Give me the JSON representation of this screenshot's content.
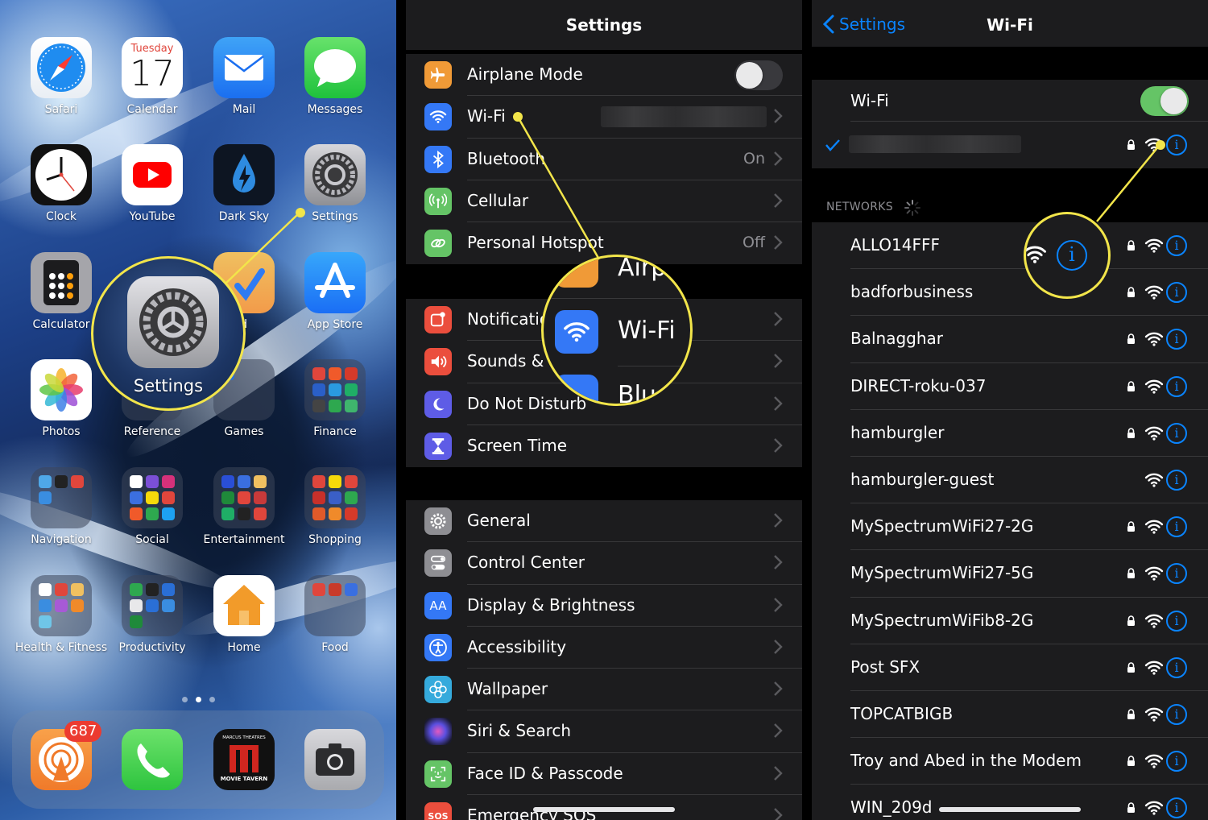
{
  "home": {
    "calendar": {
      "weekday": "Tuesday",
      "day": "17"
    },
    "apps": [
      {
        "label": "Safari",
        "icon": "safari-icon"
      },
      {
        "label": "Calendar",
        "icon": "calendar-icon"
      },
      {
        "label": "Mail",
        "icon": "mail-icon"
      },
      {
        "label": "Messages",
        "icon": "messages-icon"
      },
      {
        "label": "Clock",
        "icon": "clock-icon"
      },
      {
        "label": "YouTube",
        "icon": "youtube-icon"
      },
      {
        "label": "Dark Sky",
        "icon": "dark-sky-icon"
      },
      {
        "label": "Settings",
        "icon": "settings-gear-icon"
      },
      {
        "label": "Calculator",
        "icon": "calculator-icon"
      },
      {
        "label": "Word",
        "icon": "word-icon"
      },
      {
        "label": "App Store",
        "icon": "app-store-icon"
      },
      {
        "label": "Photos",
        "icon": "photos-icon"
      },
      {
        "label": "Reference",
        "icon": "folder-icon"
      },
      {
        "label": "Games",
        "icon": "folder-icon"
      },
      {
        "label": "Finance",
        "icon": "folder-icon"
      },
      {
        "label": "Navigation",
        "icon": "folder-icon"
      },
      {
        "label": "Social",
        "icon": "folder-icon"
      },
      {
        "label": "Entertainment",
        "icon": "folder-icon"
      },
      {
        "label": "Shopping",
        "icon": "folder-icon"
      },
      {
        "label": "Health & Fitness",
        "icon": "folder-icon"
      },
      {
        "label": "Productivity",
        "icon": "folder-icon"
      },
      {
        "label": "Home",
        "icon": "home-icon"
      },
      {
        "label": "Food",
        "icon": "folder-icon"
      }
    ],
    "word_label_partial": "ord",
    "dock": {
      "overcast_badge": "687",
      "movie_tavern_top": "MARCUS THEATRES",
      "movie_tavern_bottom": "MOVIE TAVERN"
    },
    "magnifier_label": "Settings"
  },
  "settings": {
    "title": "Settings",
    "groups": [
      [
        {
          "label": "Airplane Mode",
          "icon": "airplane-icon",
          "color": "#f09a37",
          "control": "toggle-off"
        },
        {
          "label": "Wi-Fi",
          "icon": "wifi-icon",
          "color": "#3478f6",
          "value": "",
          "control": "chevron"
        },
        {
          "label": "Bluetooth",
          "icon": "bluetooth-icon",
          "color": "#3478f6",
          "value": "On",
          "control": "chevron"
        },
        {
          "label": "Cellular",
          "icon": "cellular-icon",
          "color": "#65c466",
          "value": "",
          "control": "chevron"
        },
        {
          "label": "Personal Hotspot",
          "icon": "hotspot-icon",
          "color": "#65c466",
          "value": "Off",
          "control": "chevron"
        }
      ],
      [
        {
          "label": "Notifications",
          "icon": "notifications-icon",
          "color": "#eb4e3d",
          "value": "",
          "control": "chevron"
        },
        {
          "label": "Sounds & Haptics",
          "icon": "sounds-icon",
          "color": "#eb4e3d",
          "value": "",
          "control": "chevron"
        },
        {
          "label": "Do Not Disturb",
          "icon": "moon-icon",
          "color": "#5e5ce6",
          "value": "",
          "control": "chevron"
        },
        {
          "label": "Screen Time",
          "icon": "hourglass-icon",
          "color": "#5e5ce6",
          "value": "",
          "control": "chevron"
        }
      ],
      [
        {
          "label": "General",
          "icon": "gear-icon",
          "color": "#8e8e93",
          "value": "",
          "control": "chevron"
        },
        {
          "label": "Control Center",
          "icon": "control-center-icon",
          "color": "#8e8e93",
          "value": "",
          "control": "chevron"
        },
        {
          "label": "Display & Brightness",
          "icon": "display-icon",
          "color": "#3478f6",
          "value": "",
          "control": "chevron"
        },
        {
          "label": "Accessibility",
          "icon": "accessibility-icon",
          "color": "#3478f6",
          "value": "",
          "control": "chevron"
        },
        {
          "label": "Wallpaper",
          "icon": "wallpaper-icon",
          "color": "#35aadc",
          "value": "",
          "control": "chevron"
        },
        {
          "label": "Siri & Search",
          "icon": "siri-icon",
          "color": "#222",
          "value": "",
          "control": "chevron"
        },
        {
          "label": "Face ID & Passcode",
          "icon": "face-id-icon",
          "color": "#65c466",
          "value": "",
          "control": "chevron"
        },
        {
          "label": "Emergency SOS",
          "icon": "sos-icon",
          "color": "#eb4e3d",
          "value": "",
          "control": "chevron"
        }
      ]
    ],
    "display_icon_text": "AA",
    "sos_icon_text": "SOS",
    "magnifier": {
      "top": "Airp",
      "middle": "Wi-Fi",
      "bottom": "Blu"
    }
  },
  "wifi": {
    "back_label": "Settings",
    "title": "Wi-Fi",
    "toggle_label": "Wi-Fi",
    "toggle_on": true,
    "networks_header": "NETWORKS",
    "networks": [
      {
        "name": "ALLO14FFF",
        "locked": true
      },
      {
        "name": "badforbusiness",
        "locked": true
      },
      {
        "name": "Balnagghar",
        "locked": true
      },
      {
        "name": "DIRECT-roku-037",
        "locked": true
      },
      {
        "name": "hamburgler",
        "locked": true
      },
      {
        "name": "hamburgler-guest",
        "locked": false
      },
      {
        "name": "MySpectrumWiFi27-2G",
        "locked": true
      },
      {
        "name": "MySpectrumWiFi27-5G",
        "locked": true
      },
      {
        "name": "MySpectrumWiFib8-2G",
        "locked": true
      },
      {
        "name": "Post SFX",
        "locked": true
      },
      {
        "name": "TOPCATBIGB",
        "locked": true
      },
      {
        "name": "Troy and Abed in the Modem",
        "locked": true
      },
      {
        "name": "WIN_209d",
        "locked": true
      }
    ],
    "info_glyph": "i"
  },
  "colors": {
    "ios_blue": "#0a84ff",
    "toggle_green": "#65c466",
    "callout_yellow": "#f2e54a",
    "group_bg": "#1c1c1e"
  }
}
